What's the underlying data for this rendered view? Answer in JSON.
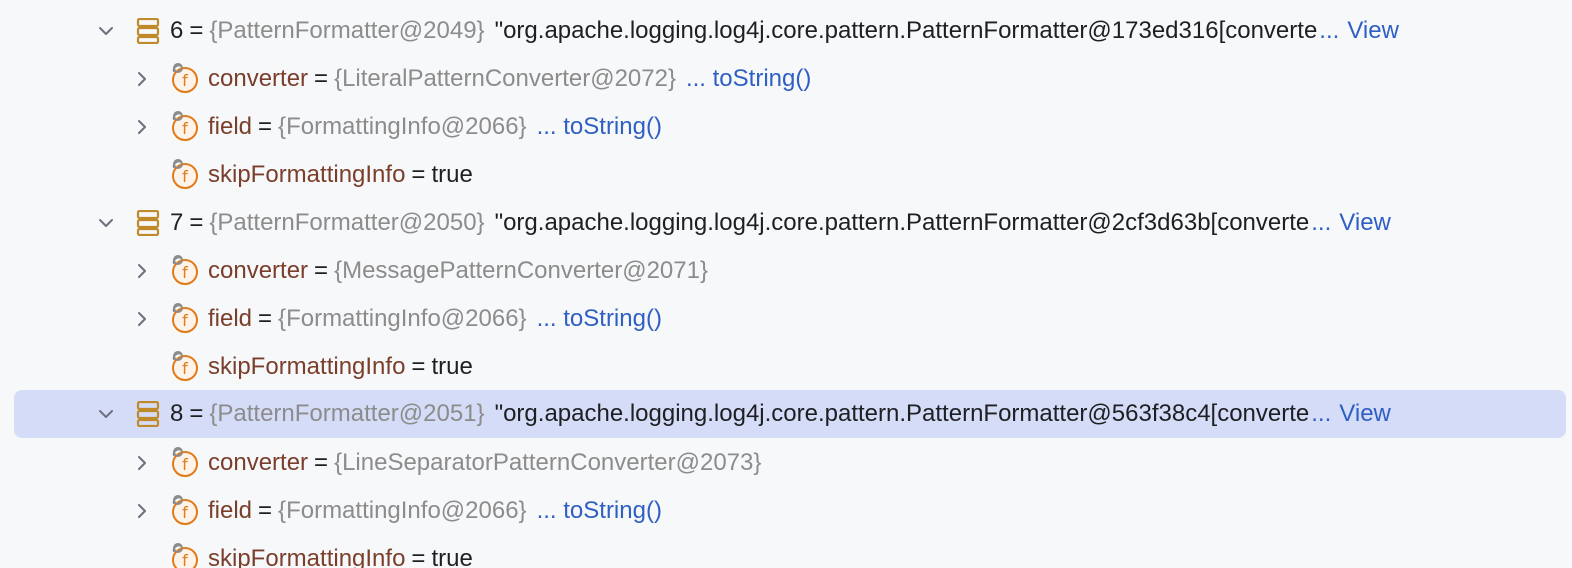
{
  "rows": [
    {
      "index": "6",
      "type": "{PatternFormatter@2049}",
      "value": "\"org.apache.logging.log4j.core.pattern.PatternFormatter@173ed316[converte",
      "ellipsis": "...",
      "view": "View",
      "children": [
        {
          "name": "converter",
          "type": "{LiteralPatternConverter@2072}",
          "link": "... toString()"
        },
        {
          "name": "field",
          "type": "{FormattingInfo@2066}",
          "link": "... toString()"
        },
        {
          "name": "skipFormattingInfo",
          "value": "true"
        }
      ]
    },
    {
      "index": "7",
      "type": "{PatternFormatter@2050}",
      "value": "\"org.apache.logging.log4j.core.pattern.PatternFormatter@2cf3d63b[converte",
      "ellipsis": "...",
      "view": "View",
      "children": [
        {
          "name": "converter",
          "type": "{MessagePatternConverter@2071}"
        },
        {
          "name": "field",
          "type": "{FormattingInfo@2066}",
          "link": "... toString()"
        },
        {
          "name": "skipFormattingInfo",
          "value": "true"
        }
      ]
    },
    {
      "index": "8",
      "type": "{PatternFormatter@2051}",
      "value": "\"org.apache.logging.log4j.core.pattern.PatternFormatter@563f38c4[converte",
      "ellipsis": "...",
      "view": "View",
      "children": [
        {
          "name": "converter",
          "type": "{LineSeparatorPatternConverter@2073}"
        },
        {
          "name": "field",
          "type": "{FormattingInfo@2066}",
          "link": "... toString()"
        },
        {
          "name": "skipFormattingInfo",
          "value": "true"
        }
      ]
    }
  ],
  "eq": "=",
  "icons": {
    "expanded": "chevron-down-icon",
    "collapsed": "chevron-right-icon",
    "array": "array-icon",
    "field": "field-icon"
  },
  "colors": {
    "background": "#f7f8fa",
    "selection": "#d5dcf7",
    "link": "#2f5fc4",
    "type": "#8c8c8c",
    "field_name": "#7a3e2b",
    "field_icon": "#e07b1a",
    "array_icon": "#c08a2b"
  }
}
